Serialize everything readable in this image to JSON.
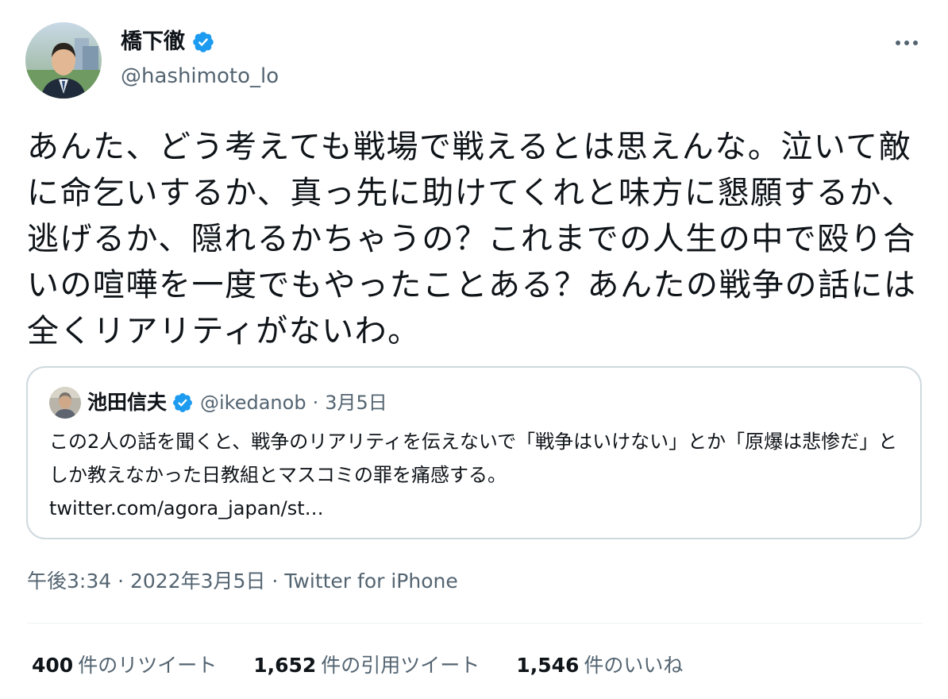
{
  "author": {
    "display_name": "橋下徹",
    "handle": "@hashimoto_lo",
    "verified_icon": "verified-badge",
    "avatar_icon": "avatar-photo"
  },
  "tweet": {
    "text": "あんた、どう考えても戦場で戦えるとは思えんな。泣いて敵に命乞いするか、真っ先に助けてくれと味方に懇願するか、逃げるか、隠れるかちゃうの？これまでの人生の中で殴り合いの喧嘩を一度でもやったことある？あんたの戦争の話には全くリアリティがないわ。"
  },
  "quoted_tweet": {
    "display_name": "池田信夫",
    "handle": "@ikedanob",
    "separator": "·",
    "date": "3月5日",
    "text": "この2人の話を聞くと、戦争のリアリティを伝えないで「戦争はいけない」とか「原爆は悲惨だ」としか教えなかった日教組とマスコミの罪を痛感する。",
    "link": "twitter.com/agora_japan/st…"
  },
  "meta": {
    "time": "午後3:34",
    "separator": "·",
    "date": "2022年3月5日",
    "source": "Twitter for iPhone"
  },
  "stats": {
    "retweets_count": "400",
    "retweets_label": "件のリツイート",
    "quotes_count": "1,652",
    "quotes_label": "件の引用ツイート",
    "likes_count": "1,546",
    "likes_label": "件のいいね"
  },
  "colors": {
    "text": "#0f1419",
    "secondary": "#536471",
    "verified": "#1d9bf0",
    "border": "#cfd9de",
    "divider": "#eff3f4"
  }
}
